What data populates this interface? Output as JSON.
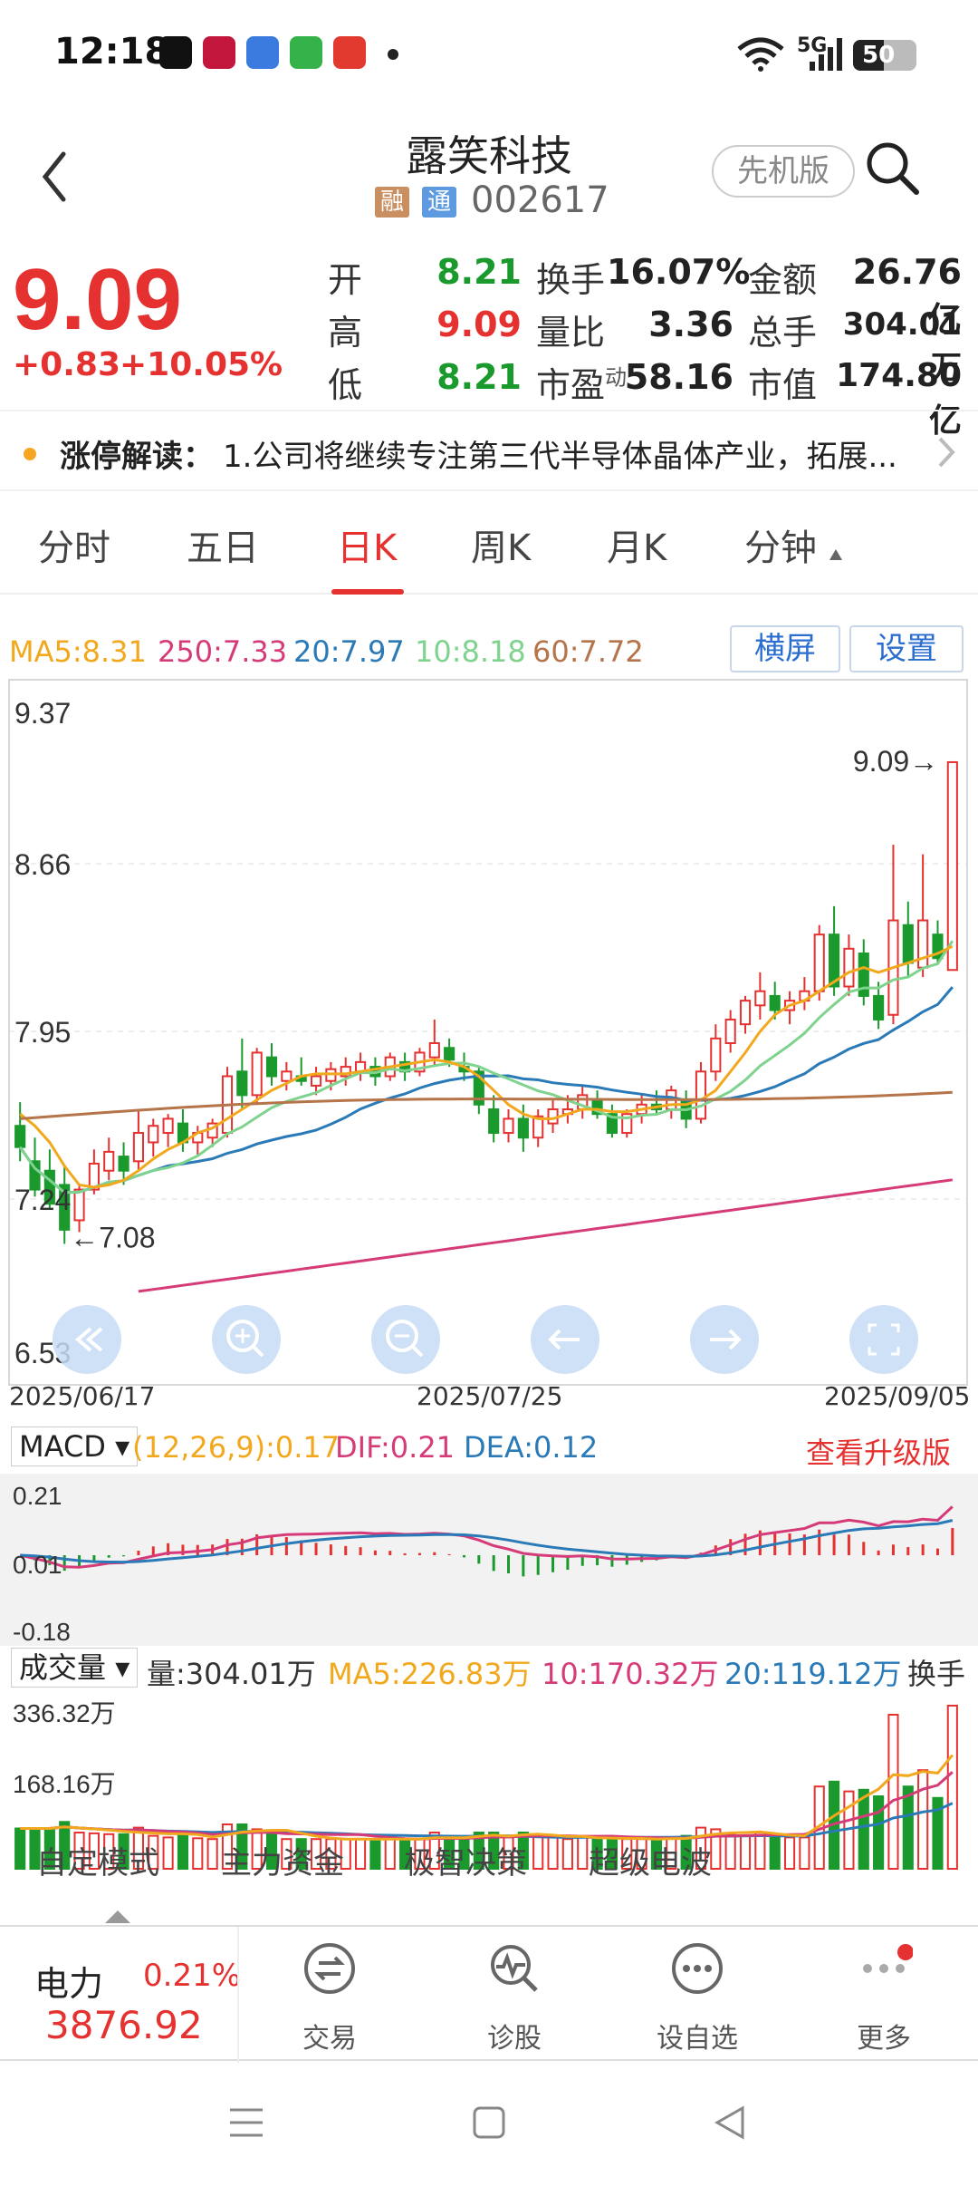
{
  "status_bar": {
    "time": "12:18",
    "network": "5G",
    "battery": "50",
    "app_icons": [
      "douyin-icon",
      "bank-icon",
      "finance-app-icon",
      "message-icon",
      "stock-app-icon"
    ]
  },
  "header": {
    "stock_name": "露笑科技",
    "tag_margin": "融",
    "tag_connect": "通",
    "stock_code": "002617",
    "pioneer_label": "先机版"
  },
  "quote": {
    "price": "9.09",
    "change": "+0.83",
    "change_pct": "+10.05%",
    "rows": [
      {
        "l1": "开",
        "v1": "8.21",
        "l2": "换手",
        "v2": "16.07%",
        "l3": "金额",
        "v3": "26.76亿"
      },
      {
        "l1": "高",
        "v1": "9.09",
        "l2": "量比",
        "v2": "3.36",
        "l3": "总手",
        "v3": "304.01万"
      },
      {
        "l1": "低",
        "v1": "8.21",
        "l2": "市盈",
        "l2_sup": "动",
        "v2": "58.16",
        "l3": "市值",
        "v3": "174.80亿"
      }
    ]
  },
  "news": {
    "title": "涨停解读：",
    "text": "1.公司将继续专注第三代半导体晶体产业，拓展..."
  },
  "tabs": [
    "分时",
    "五日",
    "日K",
    "周K",
    "月K",
    "分钟"
  ],
  "active_tab": "日K",
  "ma_legend": {
    "ma5": "MA5:8.31",
    "ma250": "250:7.33",
    "ma20": "20:7.97",
    "ma10": "10:8.18",
    "ma60": "60:7.72",
    "landscape_btn": "横屏",
    "settings_btn": "设置"
  },
  "colors": {
    "up": "#e5312f",
    "down": "#1a9a2c",
    "ma5": "#f2a81d",
    "ma10": "#7fd38e",
    "ma20": "#2a7ab8",
    "ma60": "#b5744a",
    "ma250": "#d63b79"
  },
  "chart_data": {
    "type": "candlestick",
    "y_ticks": [
      "9.37",
      "8.66",
      "7.95",
      "7.24",
      "6.53"
    ],
    "ylim": [
      6.53,
      9.37
    ],
    "x_labels": [
      "2025/06/17",
      "2025/07/25",
      "2025/09/05"
    ],
    "high_marker": "9.09",
    "low_marker": "7.08",
    "candles": [
      [
        7.55,
        7.65,
        7.4,
        7.46
      ],
      [
        7.4,
        7.5,
        7.25,
        7.28
      ],
      [
        7.36,
        7.45,
        7.2,
        7.22
      ],
      [
        7.3,
        7.38,
        7.05,
        7.11
      ],
      [
        7.15,
        7.3,
        7.1,
        7.28
      ],
      [
        7.28,
        7.45,
        7.26,
        7.39
      ],
      [
        7.36,
        7.5,
        7.32,
        7.44
      ],
      [
        7.42,
        7.48,
        7.3,
        7.36
      ],
      [
        7.4,
        7.62,
        7.36,
        7.52
      ],
      [
        7.48,
        7.58,
        7.42,
        7.55
      ],
      [
        7.52,
        7.6,
        7.46,
        7.58
      ],
      [
        7.56,
        7.62,
        7.44,
        7.48
      ],
      [
        7.48,
        7.55,
        7.42,
        7.52
      ],
      [
        7.5,
        7.58,
        7.46,
        7.56
      ],
      [
        7.52,
        7.8,
        7.5,
        7.76
      ],
      [
        7.78,
        7.92,
        7.62,
        7.68
      ],
      [
        7.68,
        7.88,
        7.64,
        7.86
      ],
      [
        7.84,
        7.9,
        7.72,
        7.76
      ],
      [
        7.74,
        7.82,
        7.7,
        7.78
      ],
      [
        7.76,
        7.84,
        7.72,
        7.74
      ],
      [
        7.72,
        7.8,
        7.68,
        7.76
      ],
      [
        7.74,
        7.82,
        7.7,
        7.79
      ],
      [
        7.76,
        7.84,
        7.72,
        7.8
      ],
      [
        7.78,
        7.86,
        7.74,
        7.82
      ],
      [
        7.8,
        7.84,
        7.72,
        7.76
      ],
      [
        7.76,
        7.86,
        7.74,
        7.84
      ],
      [
        7.82,
        7.86,
        7.74,
        7.78
      ],
      [
        7.78,
        7.88,
        7.76,
        7.86
      ],
      [
        7.84,
        8.0,
        7.8,
        7.9
      ],
      [
        7.88,
        7.92,
        7.8,
        7.83
      ],
      [
        7.8,
        7.86,
        7.74,
        7.78
      ],
      [
        7.78,
        7.8,
        7.6,
        7.64
      ],
      [
        7.62,
        7.68,
        7.48,
        7.52
      ],
      [
        7.52,
        7.62,
        7.48,
        7.58
      ],
      [
        7.58,
        7.64,
        7.44,
        7.5
      ],
      [
        7.5,
        7.62,
        7.46,
        7.59
      ],
      [
        7.56,
        7.66,
        7.52,
        7.62
      ],
      [
        7.6,
        7.68,
        7.56,
        7.62
      ],
      [
        7.62,
        7.72,
        7.58,
        7.68
      ],
      [
        7.66,
        7.7,
        7.58,
        7.6
      ],
      [
        7.6,
        7.64,
        7.5,
        7.52
      ],
      [
        7.52,
        7.62,
        7.5,
        7.6
      ],
      [
        7.6,
        7.68,
        7.56,
        7.64
      ],
      [
        7.64,
        7.7,
        7.6,
        7.62
      ],
      [
        7.62,
        7.72,
        7.58,
        7.7
      ],
      [
        7.66,
        7.7,
        7.54,
        7.58
      ],
      [
        7.58,
        7.82,
        7.56,
        7.78
      ],
      [
        7.78,
        7.98,
        7.74,
        7.92
      ],
      [
        7.9,
        8.04,
        7.86,
        8.0
      ],
      [
        7.98,
        8.1,
        7.94,
        8.08
      ],
      [
        8.06,
        8.2,
        8.0,
        8.12
      ],
      [
        8.1,
        8.16,
        8.0,
        8.04
      ],
      [
        8.04,
        8.12,
        7.98,
        8.08
      ],
      [
        8.08,
        8.18,
        8.04,
        8.12
      ],
      [
        8.12,
        8.4,
        8.08,
        8.36
      ],
      [
        8.36,
        8.48,
        8.1,
        8.14
      ],
      [
        8.14,
        8.36,
        8.1,
        8.3
      ],
      [
        8.28,
        8.34,
        8.06,
        8.1
      ],
      [
        8.1,
        8.16,
        7.96,
        8.0
      ],
      [
        8.02,
        8.74,
        7.98,
        8.42
      ],
      [
        8.4,
        8.5,
        8.18,
        8.24
      ],
      [
        8.22,
        8.7,
        8.18,
        8.42
      ],
      [
        8.36,
        8.42,
        8.24,
        8.26
      ],
      [
        8.21,
        9.09,
        8.21,
        9.09
      ]
    ],
    "ma5_series": [
      7.6,
      7.55,
      7.48,
      7.38,
      7.3,
      7.29,
      7.3,
      7.32,
      7.36,
      7.41,
      7.45,
      7.48,
      7.52,
      7.54,
      7.58,
      7.62,
      7.66,
      7.7,
      7.73,
      7.76,
      7.77,
      7.77,
      7.77,
      7.78,
      7.79,
      7.8,
      7.81,
      7.82,
      7.83,
      7.82,
      7.8,
      7.76,
      7.7,
      7.64,
      7.6,
      7.58,
      7.58,
      7.6,
      7.62,
      7.62,
      7.61,
      7.61,
      7.62,
      7.63,
      7.64,
      7.64,
      7.66,
      7.7,
      7.78,
      7.86,
      7.95,
      8.02,
      8.06,
      8.08,
      8.12,
      8.16,
      8.2,
      8.22,
      8.2,
      8.22,
      8.24,
      8.26,
      8.28,
      8.31
    ],
    "macd": {
      "params": "(12,26,9):0.17",
      "dif": "DIF:0.21",
      "dea": "DEA:0.12",
      "y_ticks": [
        "0.21",
        "0.01",
        "-0.18"
      ],
      "upgrade": "查看升级版",
      "selector": "MACD"
    },
    "volume": {
      "selector": "成交量",
      "vol": "量:304.01万",
      "ma5": "MA5:226.83万",
      "ma10": "10:170.32万",
      "ma20": "20:119.12万",
      "turnover": "换手",
      "y_ticks": [
        "336.32万",
        "168.16万"
      ]
    }
  },
  "chart_controls": [
    "rewind-icon",
    "zoom-in-icon",
    "zoom-out-icon",
    "arrow-left-icon",
    "arrow-right-icon",
    "fullscreen-icon"
  ],
  "strategy_tabs": [
    "自定模式",
    "主力资金",
    "极智决策",
    "超级电波"
  ],
  "bottom_bar": {
    "sector_name": "电力",
    "sector_pct": "0.21%",
    "sector_value": "3876.92",
    "items": [
      "交易",
      "诊股",
      "设自选",
      "更多"
    ]
  }
}
